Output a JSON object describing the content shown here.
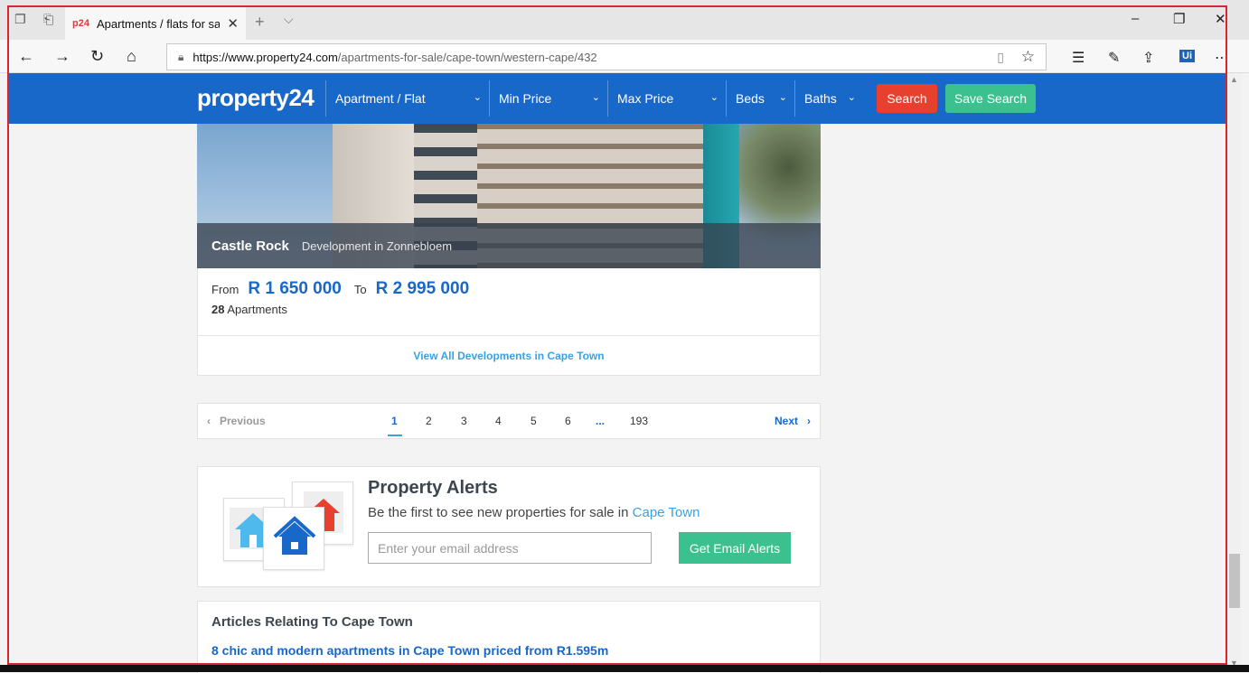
{
  "browser": {
    "tab_title": "Apartments / flats for sa",
    "favicon_text": "p24",
    "url_host": "https://www.property24.com",
    "url_path": "/apartments-for-sale/cape-town/western-cape/432"
  },
  "header": {
    "logo": "property24",
    "filters": [
      {
        "label": "Apartment / Flat"
      },
      {
        "label": "Min Price"
      },
      {
        "label": "Max Price"
      },
      {
        "label": "Beds"
      },
      {
        "label": "Baths"
      }
    ],
    "search_label": "Search",
    "save_search_label": "Save Search",
    "brand_color": "#1868c9"
  },
  "development": {
    "name": "Castle Rock",
    "subtitle": "Development in Zonnebloem",
    "from_label": "From",
    "price_from": "R 1 650 000",
    "to_label": "To",
    "price_to": "R 2 995 000",
    "count": "28",
    "count_label": "Apartments",
    "view_all": "View All Developments in Cape Town"
  },
  "pagination": {
    "previous": "Previous",
    "pages": [
      "1",
      "2",
      "3",
      "4",
      "5",
      "6"
    ],
    "ellipsis": "...",
    "last": "193",
    "next": "Next",
    "current": "1"
  },
  "alerts": {
    "title": "Property Alerts",
    "desc_prefix": "Be the first to see new properties for sale in ",
    "city": "Cape Town",
    "email_placeholder": "Enter your email address",
    "button": "Get Email Alerts"
  },
  "articles": {
    "title": "Articles Relating To Cape Town",
    "items": [
      "8 chic and modern apartments in Cape Town priced from R1.595m"
    ]
  }
}
